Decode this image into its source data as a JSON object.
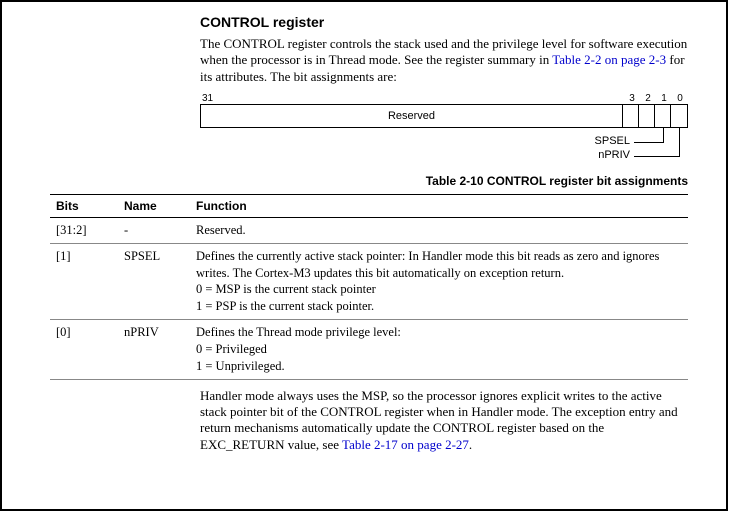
{
  "title": "CONTROL register",
  "intro_pre": "The CONTROL register controls the stack used and the privilege level for software execution when the processor is in Thread mode. See the register summary in ",
  "intro_link": "Table 2-2 on page 2-3",
  "intro_post": " for its attributes. The bit assignments are:",
  "bitfield": {
    "n31": "31",
    "n3": "3",
    "n2": "2",
    "n1": "1",
    "n0": "0",
    "reserved": "Reserved",
    "spsel": "SPSEL",
    "npriv": "nPRIV"
  },
  "table_caption": "Table 2-10 CONTROL register bit assignments",
  "columns": {
    "bits": "Bits",
    "name": "Name",
    "func": "Function"
  },
  "rows": [
    {
      "bits": "[31:2]",
      "name": "-",
      "func_lines": [
        "Reserved."
      ]
    },
    {
      "bits": "[1]",
      "name": "SPSEL",
      "func_lines": [
        "Defines the currently active stack pointer: In Handler mode this bit reads as zero and ignores writes. The Cortex-M3 updates this bit automatically on exception return.",
        "0 = MSP is the current stack pointer",
        "1 = PSP is the current stack pointer."
      ]
    },
    {
      "bits": "[0]",
      "name": "nPRIV",
      "func_lines": [
        "Defines the Thread mode privilege level:",
        "0 = Privileged",
        "1 = Unprivileged."
      ]
    }
  ],
  "footer_pre": "Handler mode always uses the MSP, so the processor ignores explicit writes to the active stack pointer bit of the CONTROL register when in Handler mode. The exception entry and return mechanisms automatically update the CONTROL register based on the EXC_RETURN value, see ",
  "footer_link": "Table 2-17 on page 2-27",
  "footer_post": "."
}
